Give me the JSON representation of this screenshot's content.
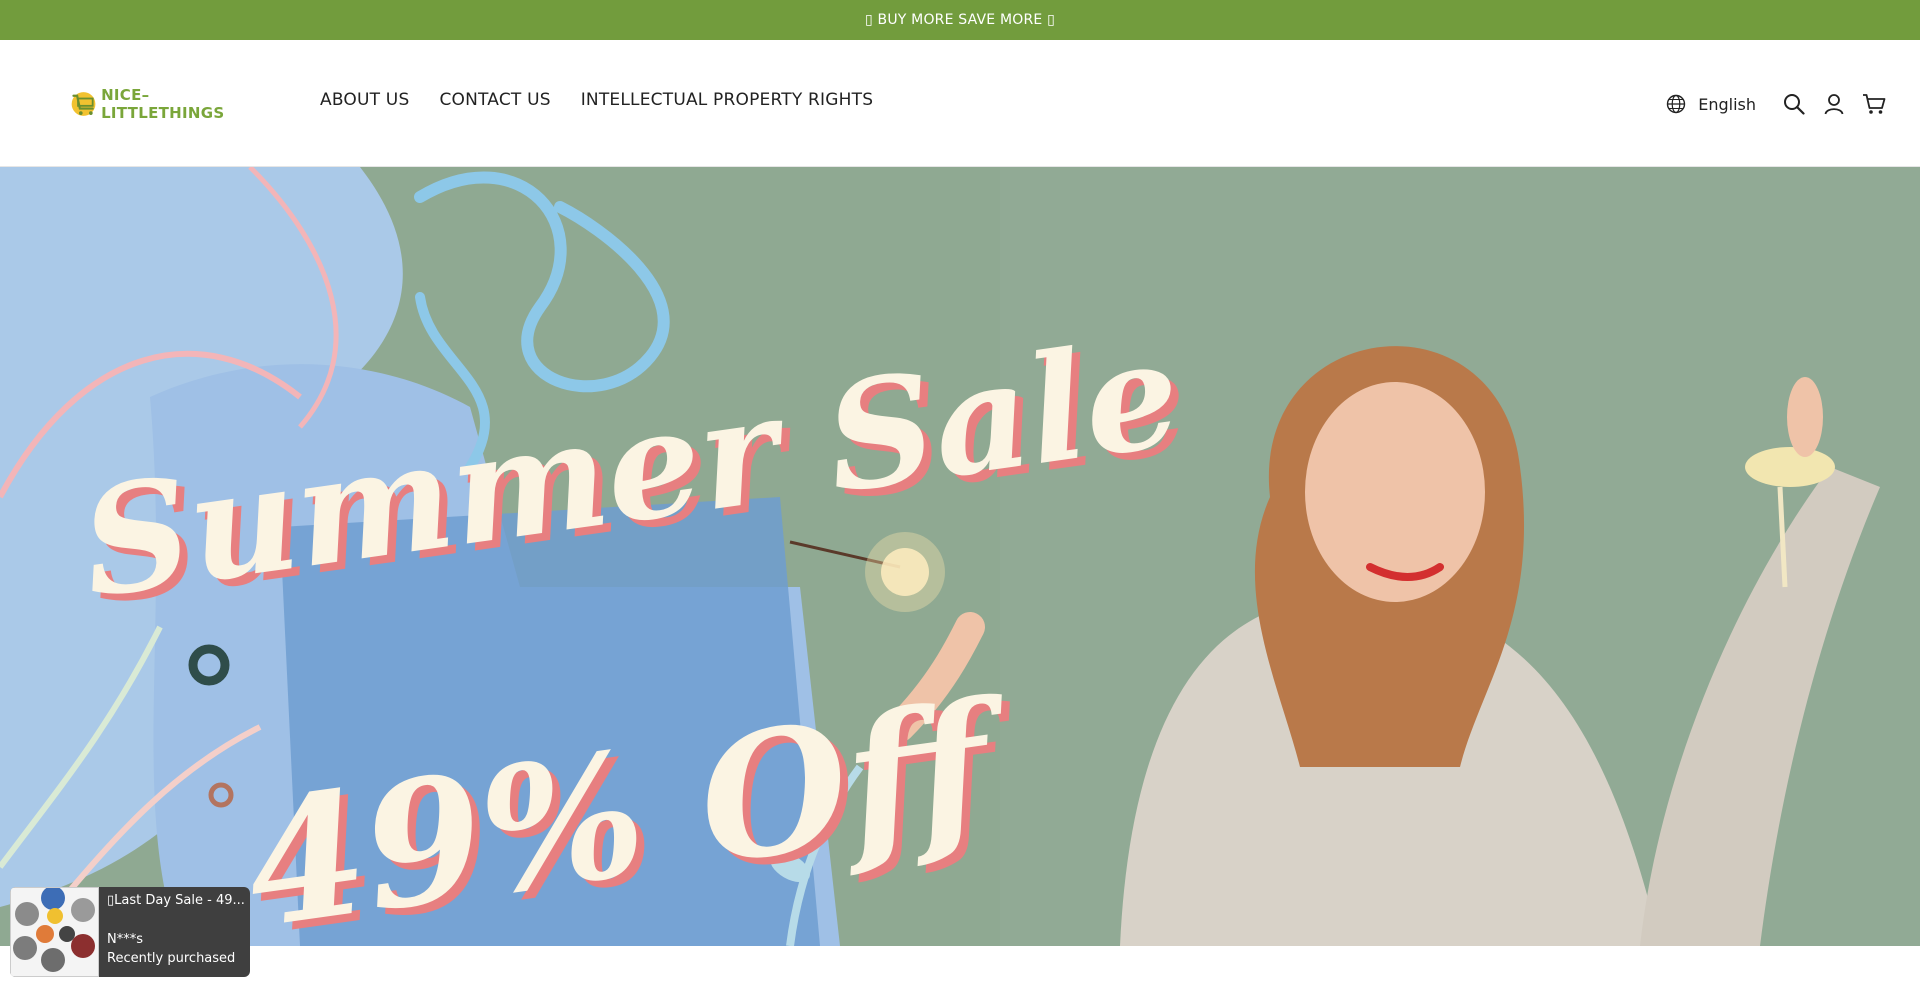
{
  "announcement": {
    "text": "▯ BUY MORE SAVE MORE ▯"
  },
  "logo": {
    "text": "NICE–LITTLETHINGS"
  },
  "nav": {
    "items": [
      {
        "label": "ABOUT US"
      },
      {
        "label": "CONTACT US"
      },
      {
        "label": "INTELLECTUAL PROPERTY RIGHTS"
      }
    ]
  },
  "tools": {
    "language": "English",
    "icons": [
      "globe-icon",
      "search-icon",
      "account-icon",
      "cart-icon"
    ]
  },
  "hero": {
    "title": "Summer Sale",
    "subtitle": "49% Off"
  },
  "toast": {
    "title": "▯Last Day Sale - 49...",
    "name": "N***s",
    "status": "Recently purchased"
  },
  "colors": {
    "announcement_bg": "#729c3d",
    "logo_green": "#7aa63a",
    "hero_bg": "#8fa992",
    "hero_text": "#fbf4e3",
    "hero_shadow": "#e77f80",
    "toast_bg": "#3f3f3f"
  }
}
